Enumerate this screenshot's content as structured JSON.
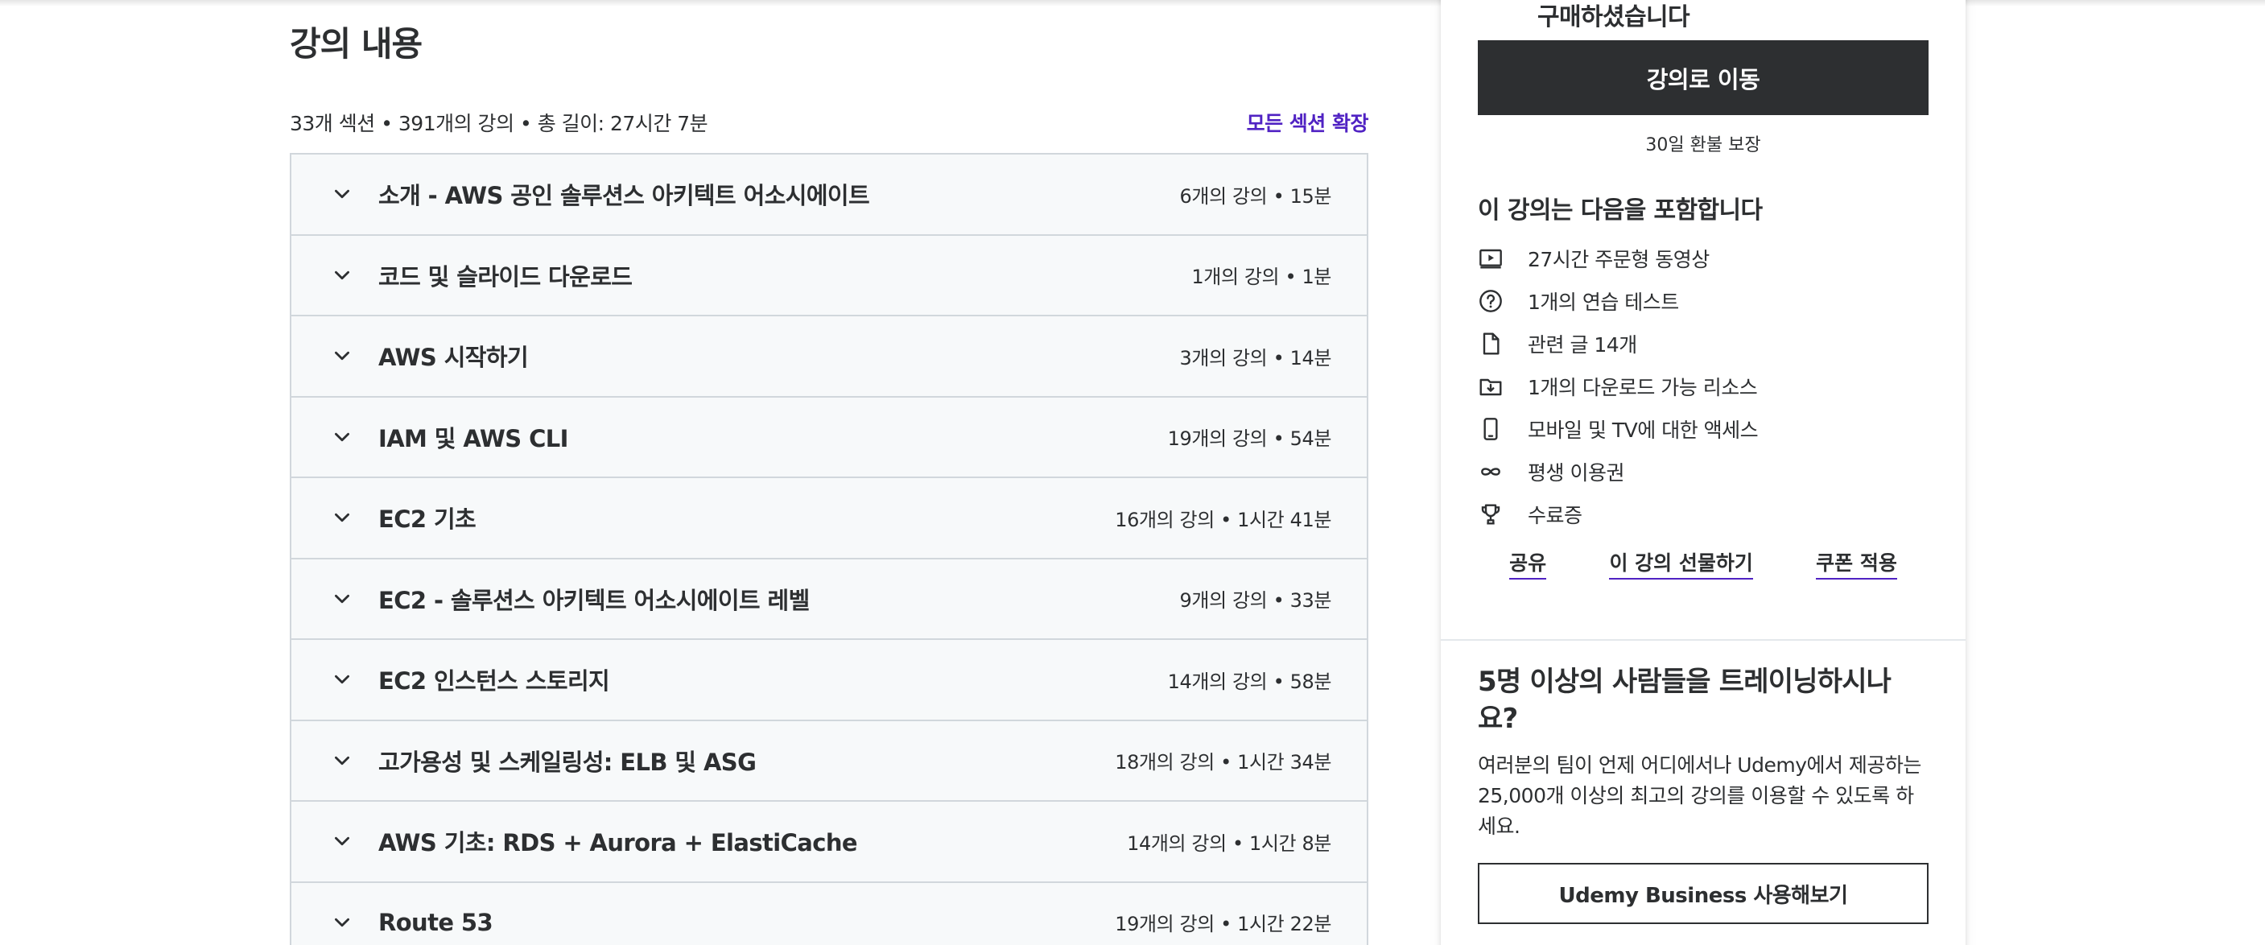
{
  "course_content": {
    "heading": "강의 내용",
    "summary": "33개 섹션 • 391개의 강의 • 총 길이: 27시간 7분",
    "expand_all": "모든 섹션 확장",
    "sections": [
      {
        "title": "소개 - AWS 공인 솔루션스 아키텍트 어소시에이트",
        "meta": "6개의 강의 • 15분"
      },
      {
        "title": "코드 및 슬라이드 다운로드",
        "meta": "1개의 강의 • 1분"
      },
      {
        "title": "AWS 시작하기",
        "meta": "3개의 강의 • 14분"
      },
      {
        "title": "IAM 및 AWS CLI",
        "meta": "19개의 강의 • 54분"
      },
      {
        "title": "EC2 기초",
        "meta": "16개의 강의 • 1시간 41분"
      },
      {
        "title": "EC2 - 솔루션스 아키텍트 어소시에이트 레벨",
        "meta": "9개의 강의 • 33분"
      },
      {
        "title": "EC2 인스턴스 스토리지",
        "meta": "14개의 강의 • 58분"
      },
      {
        "title": "고가용성 및 스케일링성: ELB 및 ASG",
        "meta": "18개의 강의 • 1시간 34분"
      },
      {
        "title": "AWS 기초: RDS + Aurora + ElastiCache",
        "meta": "14개의 강의 • 1시간 8분"
      },
      {
        "title": "Route 53",
        "meta": "19개의 강의 • 1시간 22분"
      }
    ]
  },
  "sidebar": {
    "purchased": "구매하셨습니다",
    "go_to_course": "강의로 이동",
    "refund": "30일 환불 보장",
    "includes_title": "이 강의는 다음을 포함합니다",
    "includes": [
      {
        "icon": "video-icon",
        "text": "27시간 주문형 동영상"
      },
      {
        "icon": "question-circle-icon",
        "text": "1개의 연습 테스트"
      },
      {
        "icon": "file-icon",
        "text": "관련 글 14개"
      },
      {
        "icon": "download-folder-icon",
        "text": "1개의 다운로드 가능 리소스"
      },
      {
        "icon": "mobile-icon",
        "text": "모바일 및 TV에 대한 액세스"
      },
      {
        "icon": "infinity-icon",
        "text": "평생 이용권"
      },
      {
        "icon": "trophy-icon",
        "text": "수료증"
      }
    ],
    "actions": {
      "share": "공유",
      "gift": "이 강의 선물하기",
      "coupon": "쿠폰 적용"
    },
    "business": {
      "title": "5명 이상의 사람들을 트레이닝하시나요?",
      "description": "여러분의 팀이 언제 어디에서나 Udemy에서 제공하는 25,000개 이상의 최고의 강의를 이용할 수 있도록 하세요.",
      "button": "Udemy Business 사용해보기"
    }
  },
  "colors": {
    "accent_purple": "#5022c3",
    "dark": "#2d2f31",
    "section_bg": "#f7f9fa",
    "border": "#d1d7dc"
  }
}
